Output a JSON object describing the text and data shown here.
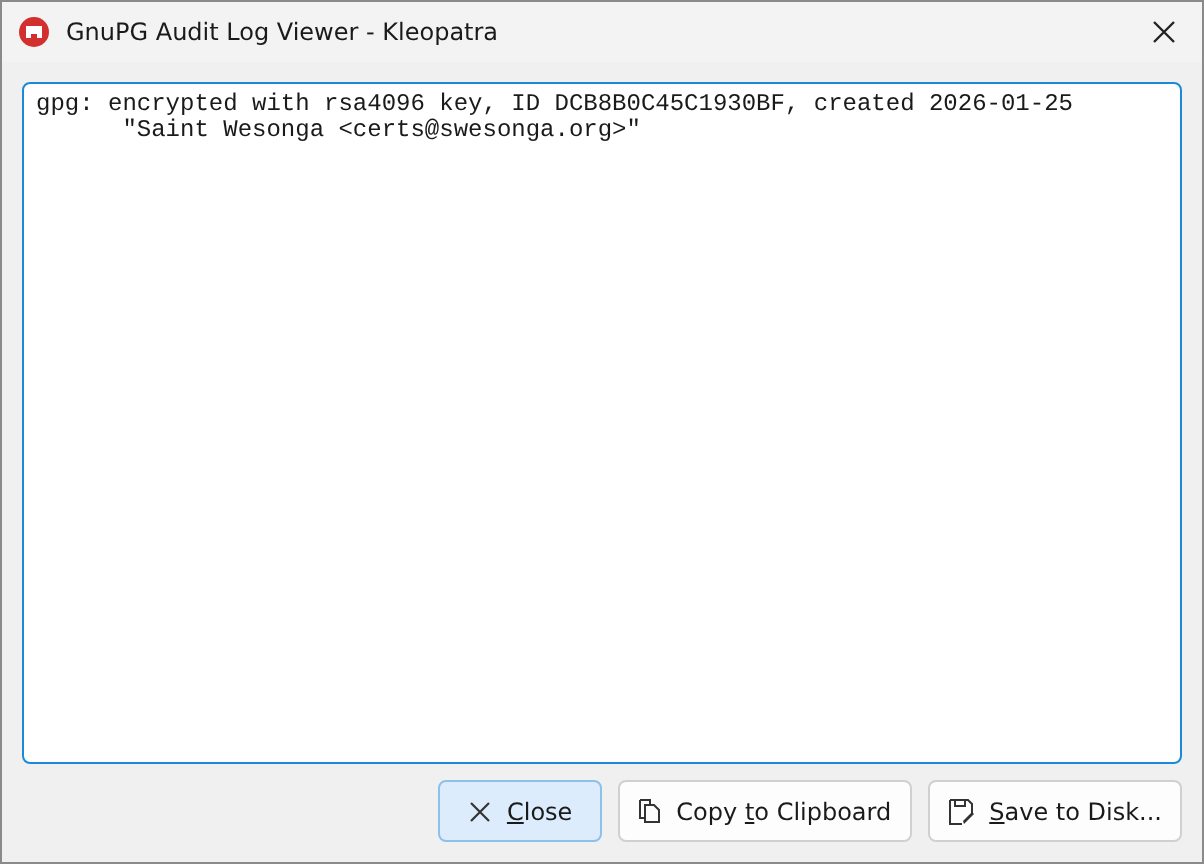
{
  "window": {
    "title": "GnuPG Audit Log Viewer - Kleopatra"
  },
  "log": {
    "lines": [
      "gpg: encrypted with rsa4096 key, ID DCB8B0C45C1930BF, created 2026-01-25",
      "      \"Saint Wesonga <certs@swesonga.org>\""
    ],
    "focused": true
  },
  "buttons": [
    {
      "kind": "close",
      "label": [
        {
          "text": "C",
          "underlined": true
        },
        {
          "text": "lose",
          "underlined": false
        }
      ],
      "default": true
    },
    {
      "kind": "copy",
      "label": [
        {
          "text": "Copy ",
          "underlined": false
        },
        {
          "text": "t",
          "underlined": true
        },
        {
          "text": "o Clipboard",
          "underlined": false
        }
      ],
      "default": false
    },
    {
      "kind": "save",
      "label": [
        {
          "text": "S",
          "underlined": true
        },
        {
          "text": "ave to Disk...",
          "underlined": false
        }
      ],
      "default": false
    }
  ]
}
